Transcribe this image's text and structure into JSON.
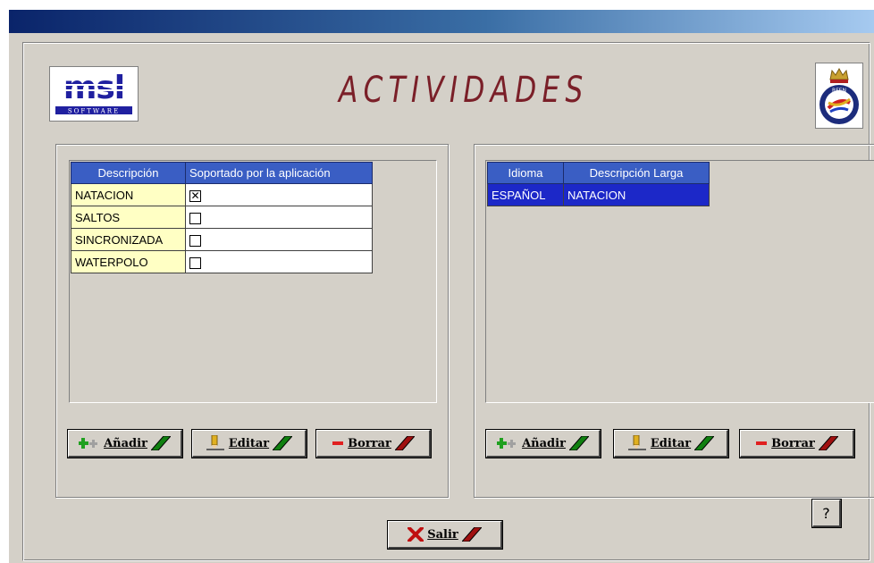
{
  "header": {
    "title": "ACTIVIDADES",
    "logo_left_text": "msl",
    "logo_left_subtext": "SOFTWARE",
    "logo_right_text": "RFEN"
  },
  "left_panel": {
    "columns": [
      "Descripción",
      "Soportado por la aplicación"
    ],
    "rows": [
      {
        "descripcion": "NATACION",
        "soportado": true
      },
      {
        "descripcion": "SALTOS",
        "soportado": false
      },
      {
        "descripcion": "SINCRONIZADA",
        "soportado": false
      },
      {
        "descripcion": "WATERPOLO",
        "soportado": false
      }
    ],
    "buttons": {
      "add": "Añadir",
      "edit": "Editar",
      "delete": "Borrar"
    }
  },
  "right_panel": {
    "columns": [
      "Idioma",
      "Descripción Larga"
    ],
    "rows": [
      {
        "idioma": "ESPAÑOL",
        "descripcion_larga": "NATACION",
        "selected": true
      }
    ],
    "buttons": {
      "add": "Añadir",
      "edit": "Editar",
      "delete": "Borrar"
    }
  },
  "footer": {
    "exit_label": "Salir",
    "help_label": "?"
  },
  "colors": {
    "title": "#7a1f28",
    "header_bg": "#3a5ec4",
    "desc_cell_bg": "#ffffc4",
    "selected_row_bg": "#1c28c8",
    "window_bg": "#d4d0c8"
  }
}
